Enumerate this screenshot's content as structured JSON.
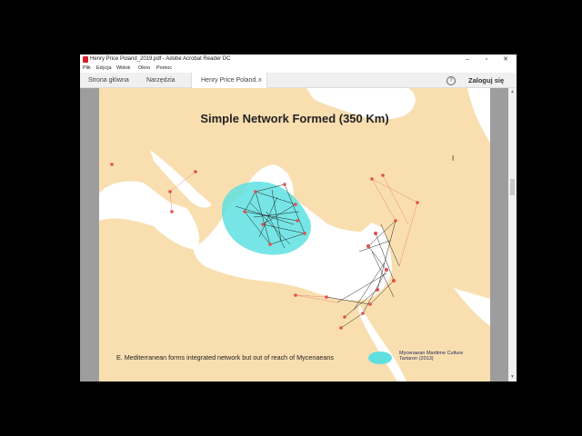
{
  "window": {
    "title": "Henry Price Poland_2019.pdf - Adobe Acrobat Reader DC",
    "controls": {
      "minimize": "–",
      "maximize": "▫",
      "close": "✕"
    }
  },
  "menu": [
    "Plik",
    "Edycja",
    "Widok",
    "Okno",
    "Pomoc"
  ],
  "tabs": {
    "home": "Strona główna",
    "tools": "Narzędzia",
    "document": "Henry Price Poland...",
    "close": "×"
  },
  "account": {
    "help": "?",
    "login": "Zaloguj się"
  },
  "slide": {
    "title": "Simple Network Formed (350 Km)",
    "caption": "E. Mediterranean forms integrated network but out of reach of Mycenaeans",
    "legend": {
      "line1": "Mycenaean Maritime Culture",
      "line2": "Tartaron (2013)",
      "swatch_color": "#5fe0e0"
    }
  },
  "colors": {
    "land": "#f9dfb0",
    "sea": "#ffffff",
    "node": "#e05050",
    "edge": "#111111"
  }
}
